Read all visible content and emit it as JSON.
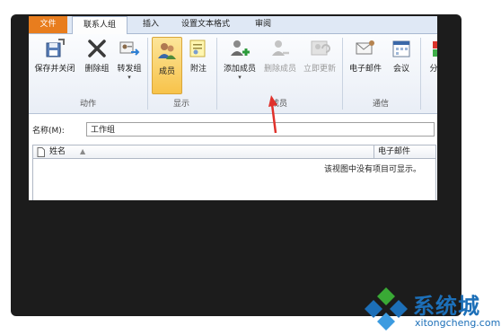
{
  "tabs": {
    "file": "文件",
    "contact_group": "联系人组",
    "insert": "插入",
    "format_text": "设置文本格式",
    "review": "审阅"
  },
  "ribbon": {
    "actions": {
      "save_close": "保存并关闭",
      "delete_group": "删除组",
      "forward_group": "转发组",
      "group_label": "动作"
    },
    "show": {
      "members": "成员",
      "notes": "附注",
      "group_label": "显示"
    },
    "members": {
      "add_members": "添加成员",
      "remove_member": "删除成员",
      "update_now": "立即更新",
      "group_label": "成员"
    },
    "communicate": {
      "email": "电子邮件",
      "meeting": "会议",
      "group_label": "通信"
    },
    "truncated_label": "分"
  },
  "form": {
    "name_label": "名称(M):",
    "name_value": "工作组"
  },
  "table": {
    "col_name": "姓名",
    "col_email": "电子邮件",
    "empty_message": "该视图中没有项目可显示。"
  },
  "watermark": {
    "brand": "系统城",
    "url": "xitongcheng.com"
  },
  "colors": {
    "file_tab": "#e87d1e",
    "selected_button": "#f7c34a",
    "arrow": "#e0312b",
    "watermark": "#1c6fb8"
  }
}
